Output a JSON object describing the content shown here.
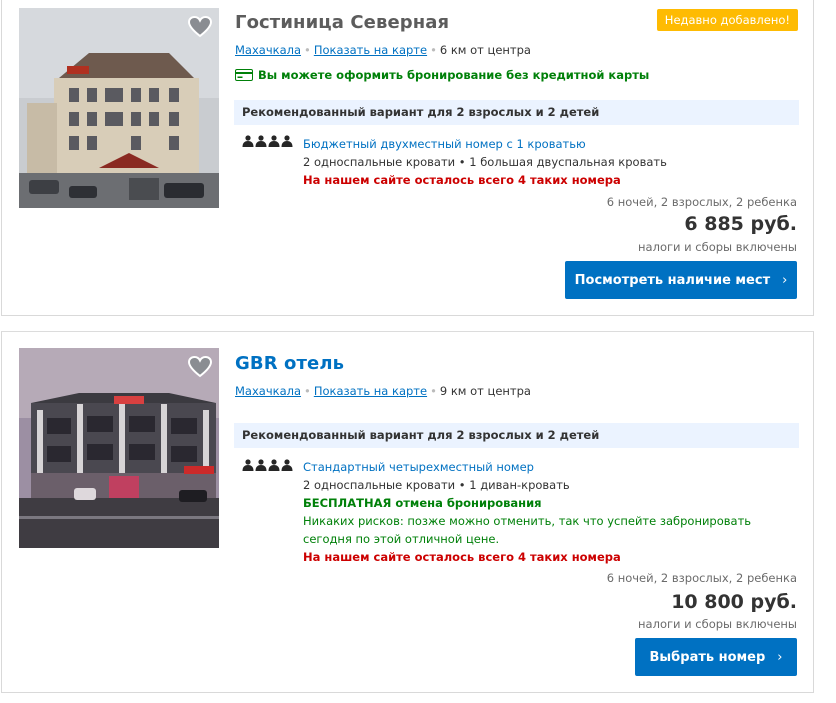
{
  "hotels": [
    {
      "name": "Гостиница Северная",
      "badge": "Недавно добавлено!",
      "city": "Махачкала",
      "map_link": "Показать на карте",
      "distance": "6 км от центра",
      "no_card": "Вы можете оформить бронирование без кредитной карты",
      "recommendation": "Рекомендованный вариант для 2 взрослых и 2 детей",
      "room_name": "Бюджетный двухместный номер с 1 кроватью",
      "beds": "2 односпальные кровати • 1 большая двуспальная кровать",
      "scarcity": "На нашем сайте осталось всего 4 таких номера",
      "stay": "6 ночей, 2 взрослых, 2 ребенка",
      "price": "6 885 руб.",
      "taxes": "налоги и сборы включены",
      "button": "Посмотреть наличие мест",
      "button_icon": "chevron-right-icon"
    },
    {
      "name": "GBR отель",
      "city": "Махачкала",
      "map_link": "Показать на карте",
      "distance": "9 км от центра",
      "recommendation": "Рекомендованный вариант для 2 взрослых и 2 детей",
      "room_name": "Стандартный четырехместный номер",
      "beds": "2 односпальные кровати • 1 диван-кровать",
      "free_cancel": "БЕСПЛАТНАЯ отмена бронирования",
      "no_risk": "Никаких рисков: позже можно отменить, так что успейте забронировать сегодня по этой отличной цене.",
      "scarcity": "На нашем сайте осталось всего 4 таких номера",
      "stay": "6 ночей, 2 взрослых, 2 ребенка",
      "price": "10 800 руб.",
      "taxes": "налоги и сборы включены",
      "button": "Выбрать номер",
      "button_icon": "chevron-right-icon"
    }
  ],
  "colors": {
    "link_blue": "#0071c2",
    "badge_yellow": "#febb02",
    "green": "#008009",
    "red": "#cc0000",
    "rec_bg": "#ebf3ff"
  }
}
